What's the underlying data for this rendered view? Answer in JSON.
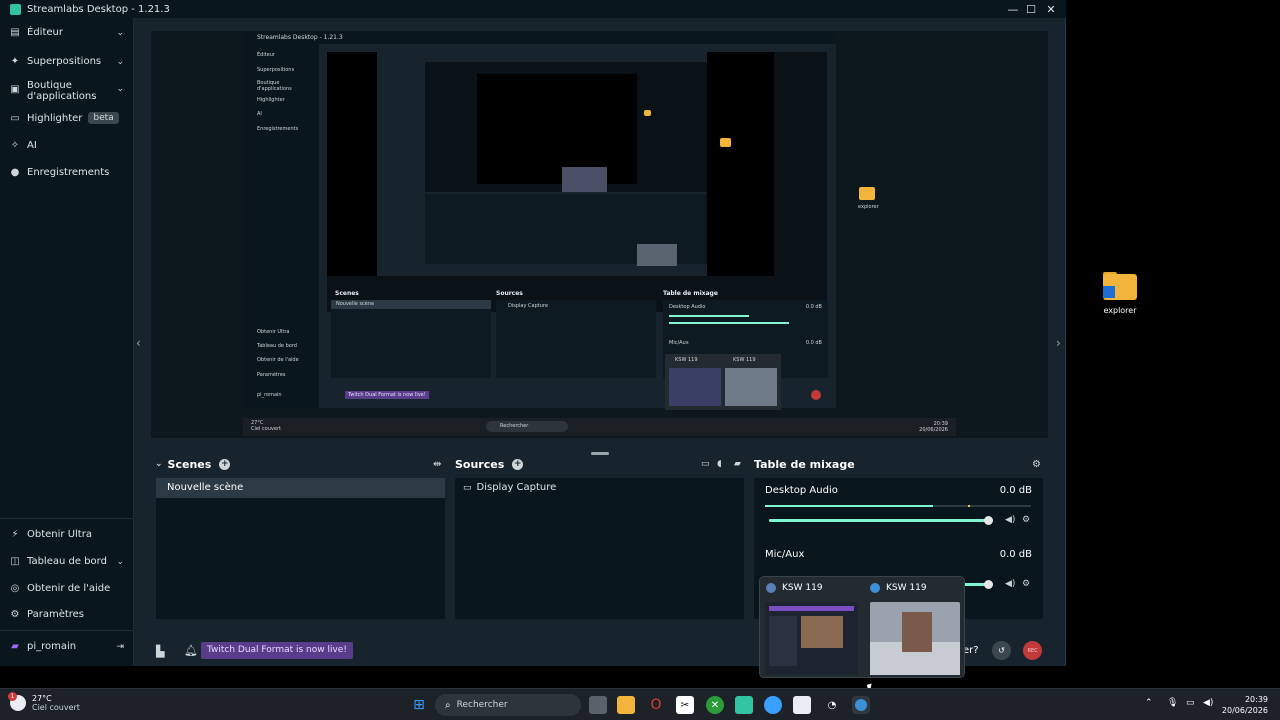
{
  "window": {
    "title": "Streamlabs Desktop - 1.21.3",
    "minimize": "—",
    "maximize": "☐",
    "close": "✕"
  },
  "sidebar": {
    "items": [
      {
        "label": "Éditeur",
        "icon": "editor-icon"
      },
      {
        "label": "Superpositions",
        "icon": "overlays-icon"
      },
      {
        "label": "Boutique d'applications",
        "icon": "app-store-icon"
      },
      {
        "label": "Highlighter",
        "badge": "beta",
        "icon": "highlighter-icon"
      },
      {
        "label": "AI",
        "icon": "ai-icon"
      },
      {
        "label": "Enregistrements",
        "icon": "recordings-icon"
      }
    ],
    "bottom_items": [
      {
        "label": "Obtenir Ultra",
        "icon": "ultra-icon"
      },
      {
        "label": "Tableau de bord",
        "icon": "dashboard-icon"
      },
      {
        "label": "Obtenir de l'aide",
        "icon": "help-icon"
      },
      {
        "label": "Paramètres",
        "icon": "settings-icon"
      }
    ],
    "user": "pi_romain"
  },
  "scenes": {
    "title": "Scenes",
    "items": [
      "Nouvelle scène"
    ]
  },
  "sources": {
    "title": "Sources",
    "items": [
      "Display Capture"
    ]
  },
  "mixer": {
    "title": "Table de mixage",
    "channels": [
      {
        "name": "Desktop Audio",
        "db": "0.0 dB",
        "level": 0.63,
        "volume": 1.0
      },
      {
        "name": "Mic/Aux",
        "db": "0.0 dB",
        "level": 0.0,
        "volume": 1.0
      }
    ]
  },
  "footer": {
    "banner": "Twitch Dual Format is now live!",
    "partial_text": "er?",
    "rec": "REC"
  },
  "thumbnail_popup": {
    "items": [
      {
        "title": "KSW 119"
      },
      {
        "title": "KSW 119"
      }
    ]
  },
  "nested_preview": {
    "title": "Streamlabs Desktop - 1.21.3",
    "sidebar": [
      "Éditeur",
      "Superpositions",
      "Boutique d'applications",
      "Highlighter",
      "AI",
      "Enregistrements"
    ],
    "sidebar_bottom": [
      "Obtenir Ultra",
      "Tableau de bord",
      "Obtenir de l'aide",
      "Paramètres",
      "pi_romain"
    ],
    "scenes": "Scenes",
    "scene_item": "Nouvelle scène",
    "sources": "Sources",
    "source_item": "Display Capture",
    "mixer": "Table de mixage",
    "desktop_audio": "Desktop Audio",
    "mic": "Mic/Aux",
    "db": "0.0 dB",
    "thumb1": "KSW 119",
    "thumb2": "KSW 119",
    "banner": "Twitch Dual Format is now live!",
    "folder_label": "explorer",
    "weather_temp": "27°C",
    "weather_desc": "Ciel couvert",
    "search": "Rechercher",
    "time": "20:39",
    "date": "20/06/2026"
  },
  "desktop_icon": {
    "label": "explorer"
  },
  "taskbar": {
    "weather_temp": "27°C",
    "weather_desc": "Ciel couvert",
    "weather_badge": "1",
    "search": "Rechercher",
    "time": "20:39",
    "date": "20/06/2026"
  },
  "colors": {
    "app_bg": "#17242d",
    "sidebar_bg": "#09161d",
    "accent": "#80f5d2",
    "twitch_purple": "#5a3d8a",
    "rec_red": "#c23a3a"
  }
}
